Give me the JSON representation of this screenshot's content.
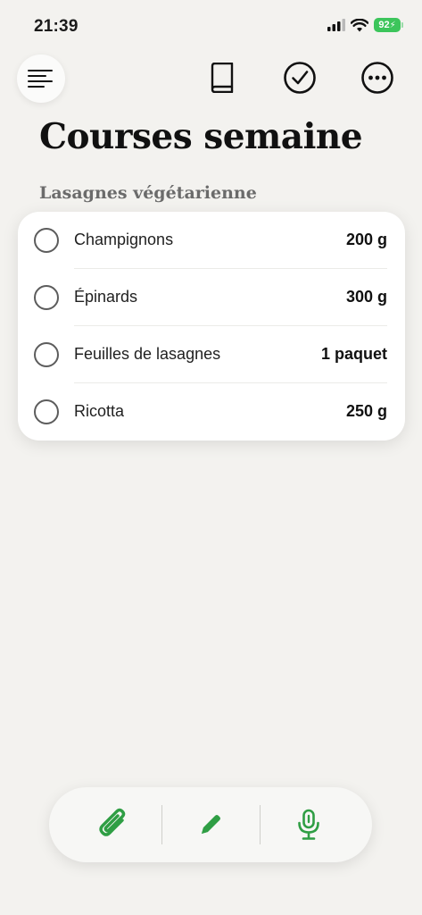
{
  "status_bar": {
    "time": "21:39",
    "battery": "92",
    "icons": [
      "cellular-signal-icon",
      "wifi-icon",
      "battery-charging-icon"
    ]
  },
  "toolbar": {
    "icons": [
      "menu-icon",
      "book-icon",
      "checkmark-circle-icon",
      "more-icon"
    ]
  },
  "note": {
    "title": "Courses semaine",
    "section": "Lasagnes végétarienne",
    "items": [
      {
        "name": "Champignons",
        "quantity": "200 g",
        "checked": false
      },
      {
        "name": "Épinards",
        "quantity": "300 g",
        "checked": false
      },
      {
        "name": "Feuilles de lasagnes",
        "quantity": "1 paquet",
        "checked": false
      },
      {
        "name": "Ricotta",
        "quantity": "250 g",
        "checked": false
      }
    ]
  },
  "bottom_bar": {
    "icons": [
      "paperclip-icon",
      "pencil-icon",
      "microphone-icon"
    ],
    "accent_color": "#2f9e44"
  },
  "colors": {
    "background": "#f3f2ef",
    "card": "#ffffff",
    "battery": "#3cc55b"
  }
}
